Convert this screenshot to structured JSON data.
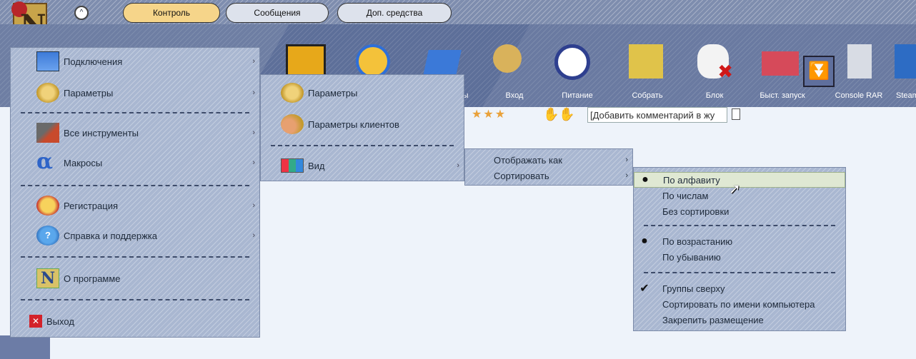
{
  "tabs": [
    {
      "label": "Контроль",
      "active": true
    },
    {
      "label": "Сообщения",
      "active": false
    },
    {
      "label": "Доп. средства",
      "active": false
    }
  ],
  "toolbar": {
    "labels": {
      "partial": "мы",
      "login": "Вход",
      "power": "Питание",
      "collect": "Собрать",
      "block": "Блок",
      "quickstart": "Быст. запуск",
      "rar": "Console RAR",
      "steam": "Steam"
    },
    "comment_placeholder": "[Добавить комментарий в жу"
  },
  "main_menu": {
    "items": [
      {
        "label": "Подключения",
        "icon": "connections-icon",
        "has_submenu": true
      },
      {
        "label": "Параметры",
        "icon": "gear-icon",
        "has_submenu": true
      },
      {
        "label": "Все инструменты",
        "icon": "tools-icon",
        "has_submenu": true
      },
      {
        "label": "Макросы",
        "icon": "alpha-icon",
        "has_submenu": true
      },
      {
        "label": "Регистрация",
        "icon": "registration-icon",
        "has_submenu": true
      },
      {
        "label": "Справка и поддержка",
        "icon": "help-icon",
        "has_submenu": true
      },
      {
        "label": "О программе",
        "icon": "about-icon",
        "has_submenu": false
      },
      {
        "label": "Выход",
        "icon": "exit-icon",
        "has_submenu": false
      }
    ]
  },
  "params_menu": {
    "items": [
      {
        "label": "Параметры",
        "icon": "gear-icon"
      },
      {
        "label": "Параметры клиентов",
        "icon": "clients-gear-icon"
      },
      {
        "label": "Вид",
        "icon": "grid-icon",
        "has_submenu": true
      }
    ]
  },
  "view_menu": {
    "items": [
      {
        "label": "Отображать как",
        "has_submenu": true
      },
      {
        "label": "Сортировать",
        "has_submenu": true
      }
    ]
  },
  "sort_menu": {
    "items": [
      {
        "label": "По алфавиту",
        "mark": "●",
        "hover": true
      },
      {
        "label": "По числам",
        "mark": ""
      },
      {
        "label": "Без сортировки",
        "mark": ""
      },
      {
        "label": "По возрастанию",
        "mark": "●"
      },
      {
        "label": "По убыванию",
        "mark": ""
      },
      {
        "label": "Группы сверху",
        "mark": "✔"
      },
      {
        "label": "Сортировать по имени компьютера",
        "mark": ""
      },
      {
        "label": "Закрепить размещение",
        "mark": ""
      }
    ]
  },
  "glyphs": {
    "submenu_arrow": "›",
    "scroll_down": "⏬",
    "collapse": "^"
  }
}
